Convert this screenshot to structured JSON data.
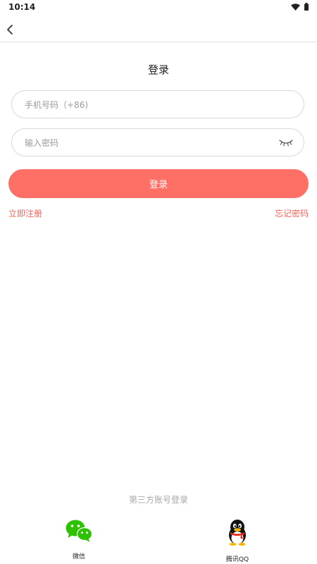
{
  "status_bar": {
    "time": "10:14"
  },
  "header": {
    "back_icon": "chevron-left-icon"
  },
  "title": "登录",
  "phone": {
    "placeholder": "手机号码（+86)",
    "value": ""
  },
  "password": {
    "placeholder": "输入密码",
    "value": "",
    "toggle_icon": "eye-closed-icon"
  },
  "login_button": {
    "label": "登录",
    "color": "#fe6f66"
  },
  "links": {
    "register": "立即注册",
    "forgot": "忘记密码",
    "color": "#f0625a"
  },
  "third_party": {
    "title": "第三方账号登录",
    "providers": [
      {
        "label": "微信",
        "icon": "wechat-icon"
      },
      {
        "label": "腾讯QQ",
        "icon": "qq-icon"
      }
    ]
  }
}
